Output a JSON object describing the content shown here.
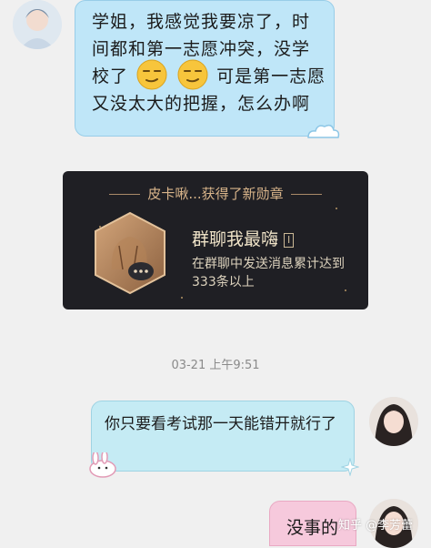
{
  "messages": {
    "incoming_lines": [
      "学姐，我感觉我要凉了，时",
      "间都和第一志愿冲突，没学",
      "校了",
      "可是第一志愿",
      "又没太大的把握，怎么办啊"
    ],
    "outgoing_1": "你只要看考试那一天能错开就行了",
    "outgoing_2": "没事的"
  },
  "badge": {
    "header": "皮卡啾...获得了新勋章",
    "title": "群聊我最嗨",
    "level": "I",
    "description": "在群聊中发送消息累计达到333条以上"
  },
  "timestamp": "03-21 上午9:51",
  "watermark": "知乎 @李芳蕾",
  "icons": {
    "emoji_1": "smirk-emoji-icon",
    "emoji_2": "smirk-emoji-icon",
    "badge": "chat-badge-icon"
  },
  "colors": {
    "incoming_bubble": "#bfe6f8",
    "outgoing_bubble": "#c5ebf4",
    "outgoing_bubble_2": "#f6c9dc",
    "badge_card": "#1f1f24",
    "badge_accent": "#d8b48a"
  }
}
